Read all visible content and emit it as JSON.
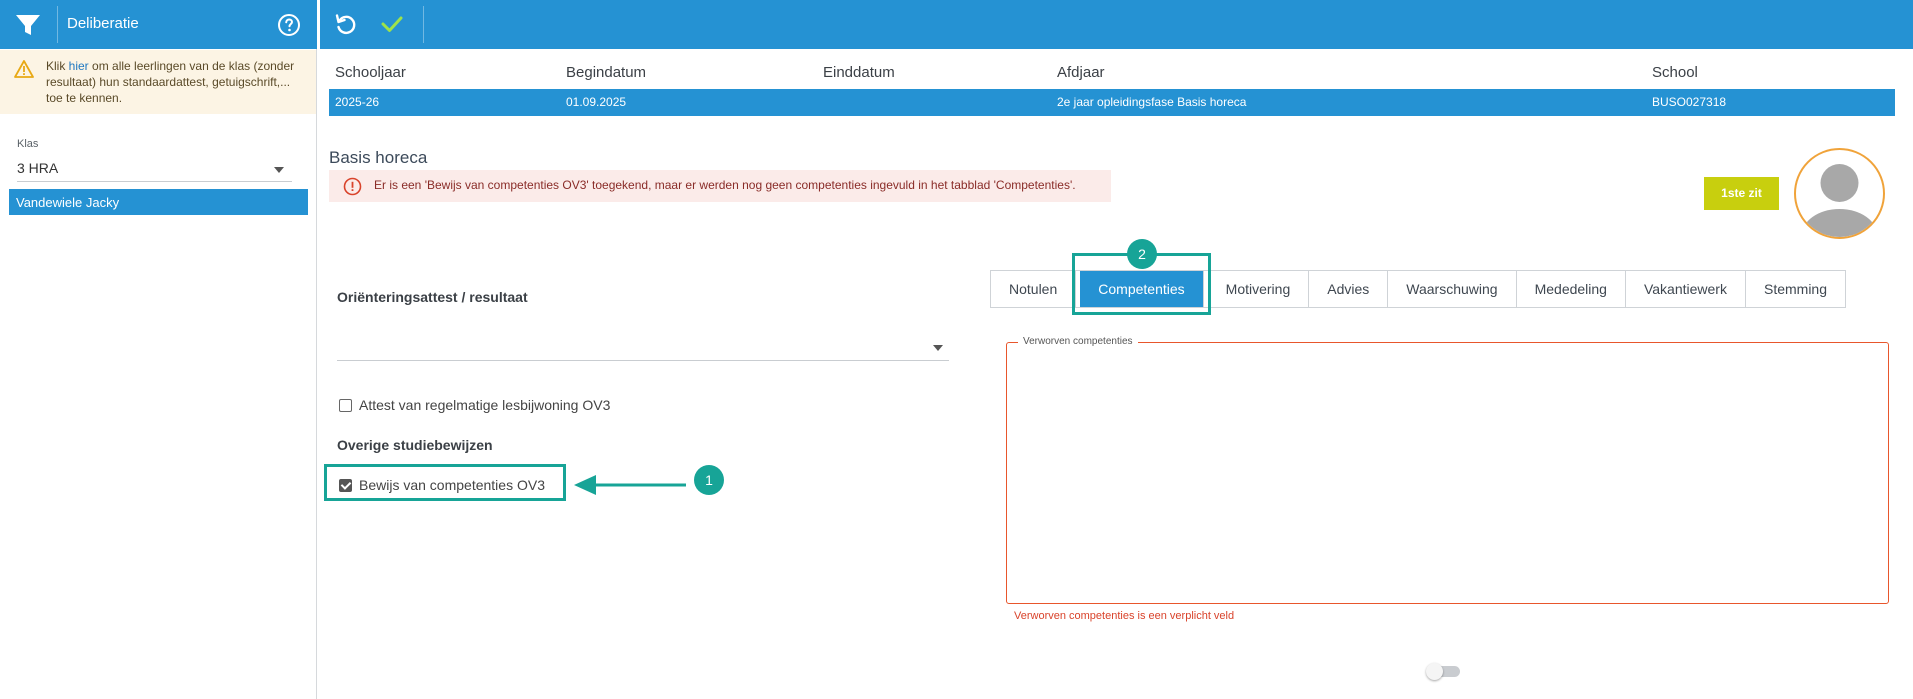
{
  "sidebar": {
    "title": "Deliberatie",
    "notice": {
      "prefix": "Klik ",
      "link": "hier",
      "suffix": " om alle leerlingen van de klas (zonder resultaat) hun standaardattest, getuigschrift,... toe te kennen."
    },
    "klas_label": "Klas",
    "klas_value": "3 HRA",
    "students": [
      {
        "name": "Vandewiele Jacky"
      }
    ]
  },
  "info": {
    "headers": [
      "Schooljaar",
      "Begindatum",
      "Einddatum",
      "Afdjaar",
      "School"
    ],
    "values": [
      "2025-26",
      "01.09.2025",
      "",
      "2e jaar opleidingsfase Basis horeca",
      "BUSO027318"
    ]
  },
  "main": {
    "heading": "Basis horeca",
    "error": "Er is een 'Bewijs van competenties OV3' toegekend, maar er werden nog geen competenties ingevuld in het tabblad 'Competenties'.",
    "zit_button": "1ste zit",
    "orient_label": "Oriënteringsattest / resultaat",
    "orient_value": "",
    "checkbox_attest": {
      "label": "Attest van regelmatige lesbijwoning OV3",
      "checked": false
    },
    "overige_label": "Overige studiebewijzen",
    "checkbox_bewijs": {
      "label": "Bewijs van competenties OV3",
      "checked": true
    },
    "callout_1": "1",
    "callout_2": "2"
  },
  "tabs": [
    {
      "label": "Notulen",
      "active": false
    },
    {
      "label": "Competenties",
      "active": true
    },
    {
      "label": "Motivering",
      "active": false
    },
    {
      "label": "Advies",
      "active": false
    },
    {
      "label": "Waarschuwing",
      "active": false
    },
    {
      "label": "Mededeling",
      "active": false
    },
    {
      "label": "Vakantiewerk",
      "active": false
    },
    {
      "label": "Stemming",
      "active": false
    }
  ],
  "fieldset": {
    "legend": "Verworven competenties",
    "value": "",
    "error": "Verworven competenties is een verplicht veld"
  },
  "colors": {
    "primary": "#2592d3",
    "teal_highlight": "#17a497",
    "error": "#d9432b",
    "zit_button": "#c8cf0e",
    "avatar_border": "#f0a33a"
  },
  "icons": [
    "filter-icon",
    "help-icon",
    "warning-icon",
    "undo-icon",
    "check-icon",
    "error-icon",
    "avatar-icon",
    "arrow-icon",
    "chevron-down-icon"
  ]
}
